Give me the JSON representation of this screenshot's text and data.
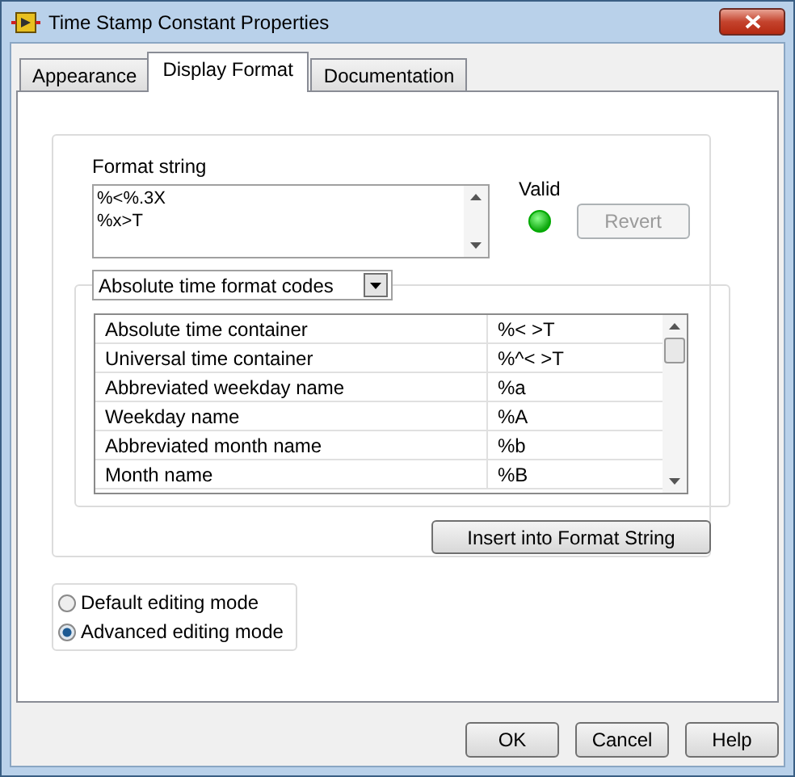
{
  "window": {
    "title": "Time Stamp Constant Properties"
  },
  "tabs": [
    {
      "label": "Appearance",
      "selected": false
    },
    {
      "label": "Display Format",
      "selected": true
    },
    {
      "label": "Documentation",
      "selected": false
    }
  ],
  "format_string": {
    "label": "Format string",
    "value": "%<%.3X\n%x>T"
  },
  "validity": {
    "label": "Valid",
    "on": true
  },
  "revert_button": {
    "label": "Revert",
    "disabled": true
  },
  "codes_dropdown": {
    "value": "Absolute time format codes"
  },
  "codes_table": {
    "rows": [
      {
        "name": "Absolute time container",
        "code": "%< >T"
      },
      {
        "name": "Universal time container",
        "code": "%^< >T"
      },
      {
        "name": "Abbreviated weekday name",
        "code": "%a"
      },
      {
        "name": "Weekday name",
        "code": "%A"
      },
      {
        "name": "Abbreviated month name",
        "code": "%b"
      },
      {
        "name": "Month name",
        "code": "%B"
      }
    ]
  },
  "insert_button": {
    "label": "Insert into Format String"
  },
  "editing_modes": [
    {
      "label": "Default editing mode",
      "selected": false
    },
    {
      "label": "Advanced editing mode",
      "selected": true
    }
  ],
  "buttons": [
    "OK",
    "Cancel",
    "Help"
  ]
}
